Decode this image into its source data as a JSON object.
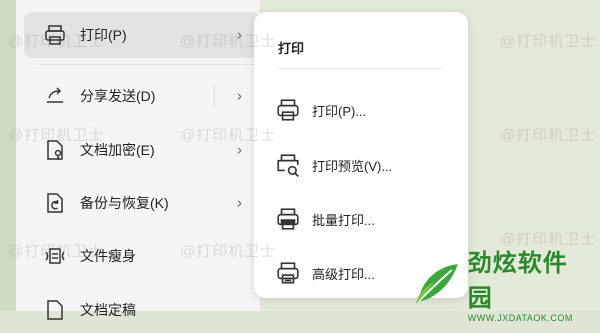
{
  "menu": {
    "items": [
      {
        "label": "打印(P)",
        "icon": "printer-icon",
        "chevron": "›"
      },
      {
        "label": "分享发送(D)",
        "icon": "share-icon",
        "chevron": "›"
      },
      {
        "label": "文档加密(E)",
        "icon": "lock-document-icon",
        "chevron": "›"
      },
      {
        "label": "备份与恢复(K)",
        "icon": "backup-restore-icon",
        "chevron": "›"
      },
      {
        "label": "文件瘦身",
        "icon": "file-slim-icon"
      },
      {
        "label": "文档定稿",
        "icon": "finalize-document-icon"
      }
    ]
  },
  "submenu": {
    "title": "打印",
    "items": [
      {
        "label": "打印(P)...",
        "icon": "printer-icon"
      },
      {
        "label": "打印预览(V)...",
        "icon": "print-preview-icon"
      },
      {
        "label": "批量打印...",
        "icon": "batch-print-icon"
      },
      {
        "label": "高级打印...",
        "icon": "advanced-print-icon"
      }
    ]
  },
  "watermark": "@打印机卫士",
  "brand": {
    "name": "劲炫软件园",
    "url": "WWW.JXDATAOK.COM",
    "color": "#2a8a2a"
  }
}
